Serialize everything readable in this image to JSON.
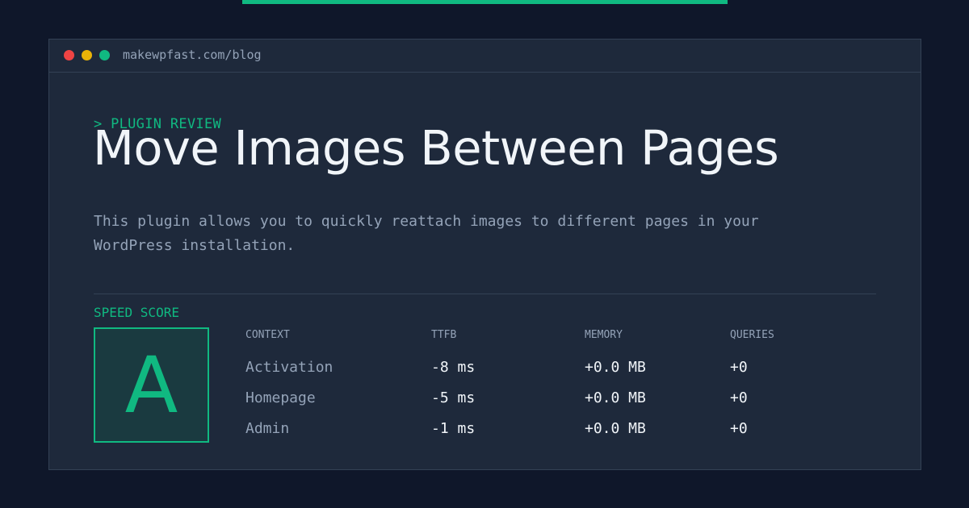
{
  "window": {
    "url": "makewpfast.com/blog"
  },
  "hero": {
    "eyebrow": "> PLUGIN REVIEW",
    "title": "Move Images Between Pages",
    "description": "This plugin allows you to quickly reattach images to different pages in your WordPress installation."
  },
  "score": {
    "label": "SPEED SCORE",
    "grade": "A"
  },
  "table": {
    "headers": [
      "CONTEXT",
      "TTFB",
      "MEMORY",
      "QUERIES"
    ],
    "rows": [
      [
        "Activation",
        "-8 ms",
        "+0.0 MB",
        "+0"
      ],
      [
        "Homepage",
        "-5 ms",
        "+0.0 MB",
        "+0"
      ],
      [
        "Admin",
        "-1 ms",
        "+0.0 MB",
        "+0"
      ]
    ]
  },
  "colors": {
    "accent": "#10b981",
    "background": "#0f172a",
    "panel": "#1e293b"
  }
}
